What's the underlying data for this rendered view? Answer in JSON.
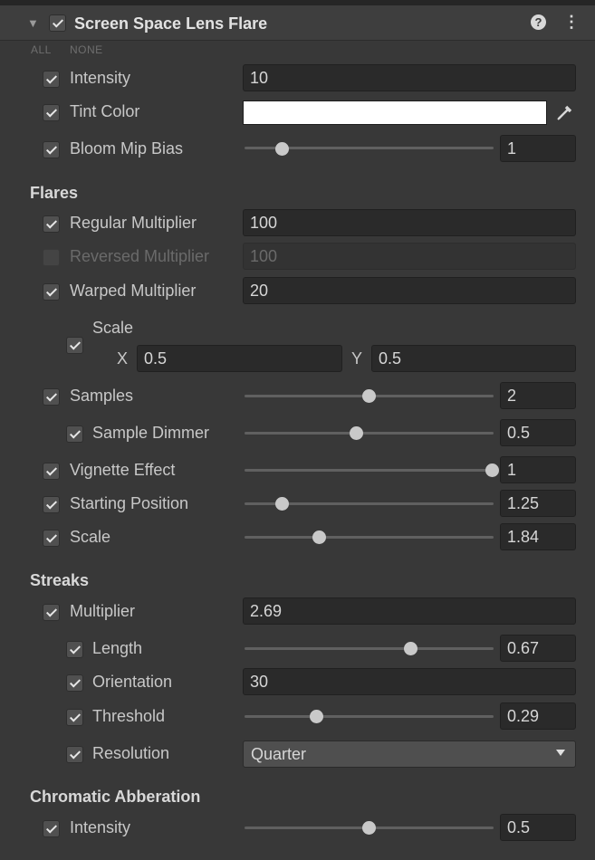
{
  "header": {
    "title": "Screen Space Lens Flare",
    "collapse_icon": "triangle-down-icon",
    "help_icon": "question-circle-icon",
    "menu_icon": "vertical-ellipsis-icon"
  },
  "toggles": {
    "all": "ALL",
    "none": "NONE"
  },
  "general": {
    "intensity": {
      "label": "Intensity",
      "value": "10"
    },
    "tint_color": {
      "label": "Tint Color",
      "color": "#ffffff"
    },
    "bloom_mip_bias": {
      "label": "Bloom Mip Bias",
      "value": "1",
      "slider": 0.15
    }
  },
  "flares": {
    "title": "Flares",
    "regular_multiplier": {
      "label": "Regular Multiplier",
      "value": "100"
    },
    "reversed_multiplier": {
      "label": "Reversed Multiplier",
      "value": "100",
      "enabled": false
    },
    "warped_multiplier": {
      "label": "Warped Multiplier",
      "value": "20"
    },
    "scale_xy": {
      "label": "Scale",
      "x_label": "X",
      "x": "0.5",
      "y_label": "Y",
      "y": "0.5"
    },
    "samples": {
      "label": "Samples",
      "value": "2",
      "slider": 0.5
    },
    "sample_dimmer": {
      "label": "Sample Dimmer",
      "value": "0.5",
      "slider": 0.45
    },
    "vignette_effect": {
      "label": "Vignette Effect",
      "value": "1",
      "slider": 1.0
    },
    "starting_position": {
      "label": "Starting Position",
      "value": "1.25",
      "slider": 0.15
    },
    "scale": {
      "label": "Scale",
      "value": "1.84",
      "slider": 0.3
    }
  },
  "streaks": {
    "title": "Streaks",
    "multiplier": {
      "label": "Multiplier",
      "value": "2.69"
    },
    "length": {
      "label": "Length",
      "value": "0.67",
      "slider": 0.67
    },
    "orientation": {
      "label": "Orientation",
      "value": "30"
    },
    "threshold": {
      "label": "Threshold",
      "value": "0.29",
      "slider": 0.29
    },
    "resolution": {
      "label": "Resolution",
      "value": "Quarter"
    }
  },
  "chromatic": {
    "title": "Chromatic Abberation",
    "intensity": {
      "label": "Intensity",
      "value": "0.5",
      "slider": 0.5
    }
  }
}
